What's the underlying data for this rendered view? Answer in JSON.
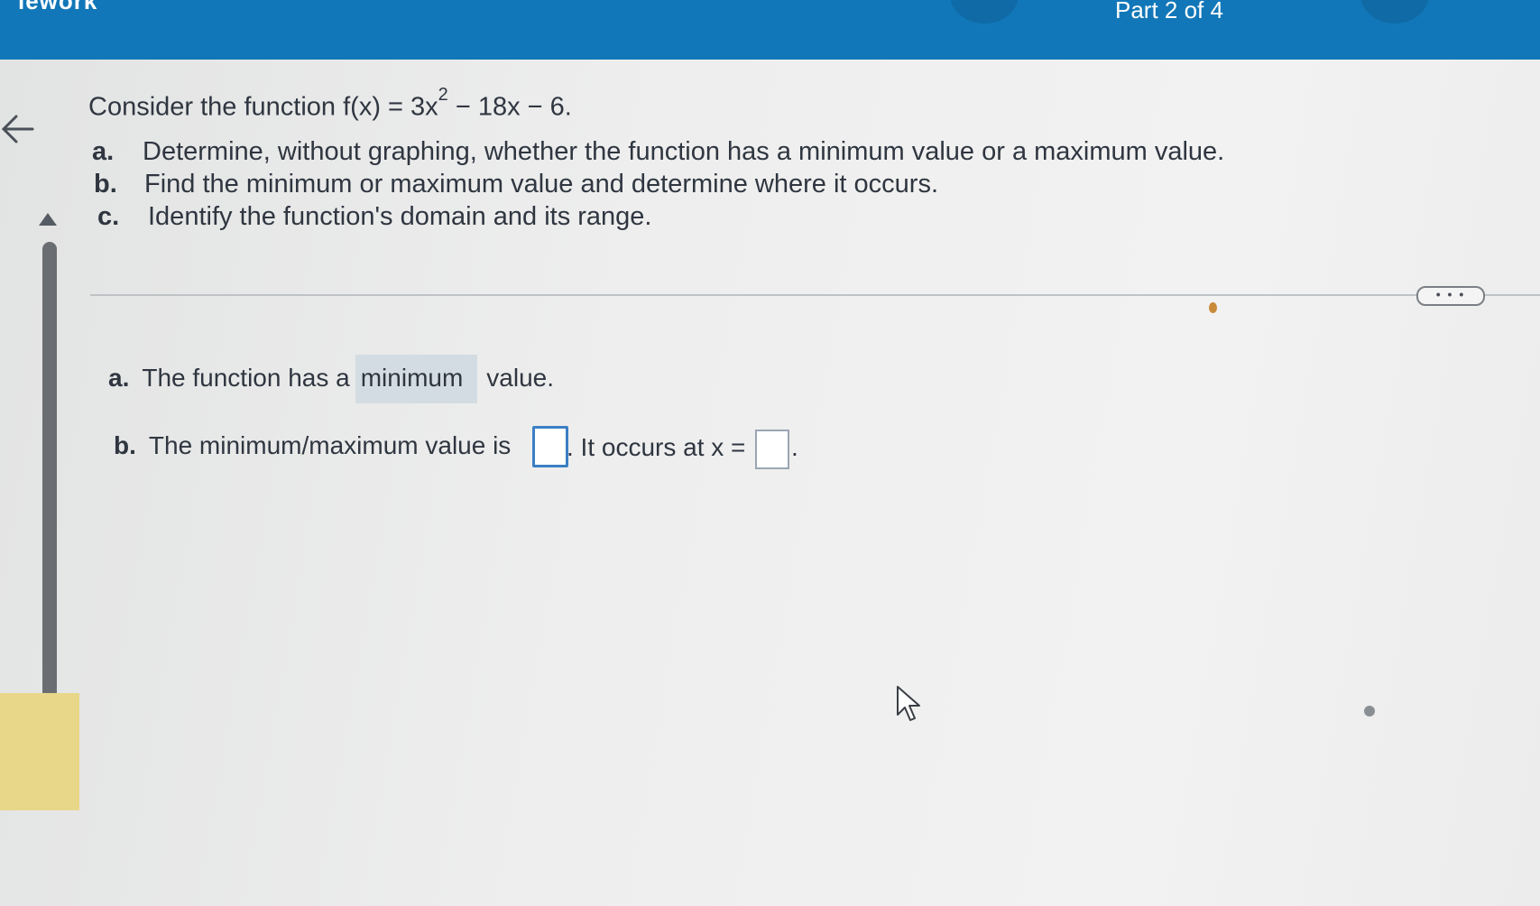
{
  "header": {
    "title": "lework",
    "part_label": "Part 2 of 4"
  },
  "question": {
    "intro": "Consider the function f(x) = 3x",
    "exponent": "2",
    "rest": " − 18x − 6.",
    "items": [
      {
        "letter": "a.",
        "text": "Determine, without graphing, whether the function has a minimum value or a maximum value."
      },
      {
        "letter": "b.",
        "text": "Find the minimum or maximum value and determine where it occurs."
      },
      {
        "letter": "c.",
        "text": "Identify the function's domain and its range."
      }
    ]
  },
  "more_button": "• • •",
  "answers": {
    "a": {
      "letter": "a.",
      "prefix": "The function has a",
      "selected": "minimum",
      "suffix": "value."
    },
    "b": {
      "letter": "b.",
      "prefix": "The minimum/maximum value is",
      "middle": ". It occurs at x =",
      "end": ".",
      "value_input": "",
      "x_input": ""
    }
  },
  "colors": {
    "header": "#1177b8",
    "background": "#e9eaea",
    "selected_answer": "#d4dce3",
    "active_input_border": "#3b7fc4"
  }
}
